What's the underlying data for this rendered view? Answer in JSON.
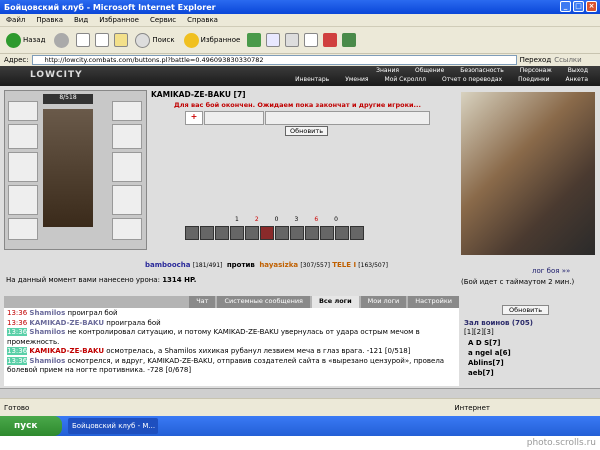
{
  "window": {
    "title": "Бойцовский клуб - Microsoft Internet Explorer"
  },
  "menu": [
    "Файл",
    "Правка",
    "Вид",
    "Избранное",
    "Сервис",
    "Справка"
  ],
  "toolbar": {
    "back": "Назад",
    "search": "Поиск",
    "favorites": "Избранное"
  },
  "address": {
    "label": "Адрес:",
    "url": "http://lowcity.combats.com/buttons.pl?battle=0.496093830330782",
    "go": "Переход",
    "links": "Ссылки"
  },
  "game": {
    "logo": "LOWCITY",
    "nav_top": [
      "Знания",
      "Общение",
      "Безопасность",
      "Персонаж",
      "Выход"
    ],
    "nav_bottom": [
      "Инвентарь",
      "Умения",
      "Мой Скроллл",
      "Отчет о переводах",
      "Поединки",
      "Анкета"
    ],
    "char_hp": "8/518",
    "opponent": "KAMIKAD-ZE-BAKU [7]",
    "end_message": "Для вас бой окончен. Ожидаем пока закончат и другие игроки...",
    "refresh": "Обновить",
    "stats": [
      "1",
      "2",
      "0",
      "3",
      "6",
      "0"
    ],
    "versus": {
      "p1": "bamboocha",
      "p1_hp": "[181/491]",
      "mid": "против",
      "p2": "hayasizka",
      "p2_hp": "[307/557]",
      "p3": "TELE I",
      "p3_hp": "[163/507]"
    },
    "damage_label": "На данный момент вами нанесено урона:",
    "damage_value": "1314 HP.",
    "log_link": "лог боя »»",
    "timeout": "(Бой идет с таймаутом 2 мин.)",
    "tabs": [
      "Чат",
      "Системные сообщения",
      "Все логи",
      "Мои логи",
      "Настройки"
    ],
    "log": [
      {
        "time": "13:36",
        "name": "Shamilos",
        "text": " проиграл бой"
      },
      {
        "time": "13:36",
        "name": "KAMIKAD-ZE-BAKU",
        "text": " проиграла бой"
      },
      {
        "time": "13:36",
        "name": "Shamilos",
        "text": " не контролировал ситуацию, и потому KAMIKAD-ZE-BAKU увернулась от удара острым мечом в промежность."
      },
      {
        "time": "13:36",
        "name": "KAMIKAD-ZE-BAKU",
        "text": " осмотрелась, а Shamilos хихикая рубанул лезвием меча в глаз врага. -121 [0/518]"
      },
      {
        "time": "13:36",
        "name": "Shamilos",
        "text": " осмотрелся, и вдруг, KAMIKAD-ZE-BAKU, отправив создателей сайта в «вырезано цензурой», провела болевой прием на ногте противника. -728 [0/678]"
      }
    ],
    "room_refresh": "Обновить",
    "room_title": "Зал воинов (705)",
    "room_pages": "[1][2][3]",
    "players": [
      "A D S[7]",
      "a ngel a[6]",
      "Ablins[7]",
      "aeb[7]"
    ]
  },
  "status": {
    "ready": "Готово",
    "zone": "Интернет"
  },
  "taskbar": {
    "start": "пуск",
    "task": "Бойцовский клуб - M..."
  },
  "watermark": "photo.scrolls.ru"
}
